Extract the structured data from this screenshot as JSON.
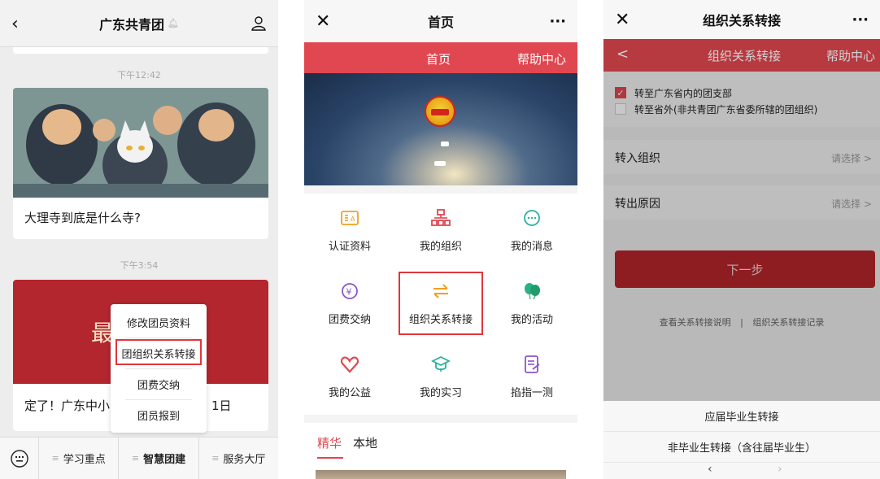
{
  "panel1": {
    "title": "广东共青团",
    "back_icon": "back-chevron-icon",
    "profile_icon": "person-icon",
    "time1": "下午12:42",
    "card1_title": "大理寺到底是什么寺?",
    "time2": "下午3:54",
    "card2_big_text": "最",
    "card2_title": "定了！广东中小",
    "card2_title_tail": "1日",
    "popup_menu": {
      "items": [
        "修改团员资料",
        "团组织关系转接",
        "团费交纳",
        "团员报到"
      ]
    },
    "bottom_bar": {
      "keyboard_icon": "keyboard-icon",
      "items": [
        "学习重点",
        "智慧团建",
        "服务大厅"
      ]
    }
  },
  "panel2": {
    "title": "首页",
    "close_icon": "close-icon",
    "more_label": "···",
    "nav": {
      "home": "首页",
      "help": "帮助中心"
    },
    "grid": [
      {
        "label": "认证资料",
        "icon": "id-card-icon",
        "color": "#f0a020"
      },
      {
        "label": "我的组织",
        "icon": "org-chart-icon",
        "color": "#e04750"
      },
      {
        "label": "我的消息",
        "icon": "message-icon",
        "color": "#2bb0a0"
      },
      {
        "label": "团费交纳",
        "icon": "yuan-icon",
        "color": "#8a56c8"
      },
      {
        "label": "组织关系转接",
        "icon": "transfer-arrows-icon",
        "color": "#f0a020"
      },
      {
        "label": "我的活动",
        "icon": "balloons-icon",
        "color": "#2bb080"
      },
      {
        "label": "我的公益",
        "icon": "heart-icon",
        "color": "#e04750"
      },
      {
        "label": "我的实习",
        "icon": "graduation-cap-icon",
        "color": "#2bb0a0"
      },
      {
        "label": "掐指一测",
        "icon": "notepad-icon",
        "color": "#8a56c8"
      }
    ],
    "tabs": [
      "精华",
      "本地"
    ]
  },
  "panel3": {
    "title": "组织关系转接",
    "close_icon": "close-icon",
    "more_label": "···",
    "nav": {
      "back": "<",
      "title": "组织关系转接",
      "help": "帮助中心"
    },
    "options": [
      {
        "label": "转至广东省内的团支部",
        "checked": true
      },
      {
        "label": "转至省外(非共青团广东省委所辖的团组织)",
        "checked": false
      }
    ],
    "rows": [
      {
        "label": "转入组织",
        "value": "请选择 >"
      },
      {
        "label": "转出原因",
        "value": "请选择 >"
      }
    ],
    "next_button": "下一步",
    "links": {
      "left": "查看关系转接说明",
      "divider": "|",
      "right": "组织关系转接记录"
    },
    "sheet": [
      "应届毕业生转接",
      "非毕业生转接（含往届毕业生）"
    ]
  },
  "colors": {
    "accent": "#e04750",
    "highlight_box": "#e0363b",
    "dark_red": "#b6262c"
  }
}
